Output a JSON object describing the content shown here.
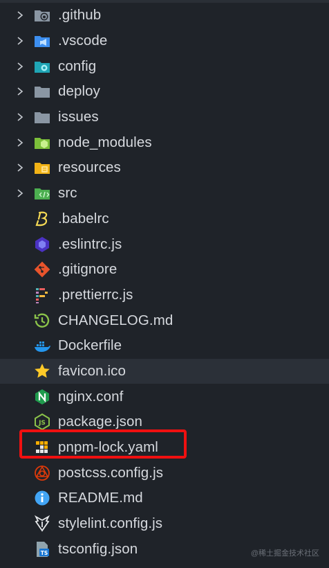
{
  "explorer": {
    "items": [
      {
        "label": ".github",
        "icon": "github-folder-icon",
        "folder": true
      },
      {
        "label": ".vscode",
        "icon": "vscode-folder-icon",
        "folder": true
      },
      {
        "label": "config",
        "icon": "config-folder-icon",
        "folder": true
      },
      {
        "label": "deploy",
        "icon": "folder-icon",
        "folder": true
      },
      {
        "label": "issues",
        "icon": "folder-icon",
        "folder": true
      },
      {
        "label": "node_modules",
        "icon": "node-folder-icon",
        "folder": true
      },
      {
        "label": "resources",
        "icon": "resources-folder-icon",
        "folder": true
      },
      {
        "label": "src",
        "icon": "src-folder-icon",
        "folder": true
      },
      {
        "label": ".babelrc",
        "icon": "babel-icon",
        "folder": false
      },
      {
        "label": ".eslintrc.js",
        "icon": "eslint-icon",
        "folder": false
      },
      {
        "label": ".gitignore",
        "icon": "git-icon",
        "folder": false
      },
      {
        "label": ".prettierrc.js",
        "icon": "prettier-icon",
        "folder": false
      },
      {
        "label": "CHANGELOG.md",
        "icon": "changelog-icon",
        "folder": false
      },
      {
        "label": "Dockerfile",
        "icon": "docker-icon",
        "folder": false
      },
      {
        "label": "favicon.ico",
        "icon": "star-icon",
        "folder": false
      },
      {
        "label": "nginx.conf",
        "icon": "nginx-icon",
        "folder": false
      },
      {
        "label": "package.json",
        "icon": "nodejs-icon",
        "folder": false
      },
      {
        "label": "pnpm-lock.yaml",
        "icon": "pnpm-icon",
        "folder": false
      },
      {
        "label": "postcss.config.js",
        "icon": "postcss-icon",
        "folder": false
      },
      {
        "label": "README.md",
        "icon": "info-icon",
        "folder": false
      },
      {
        "label": "stylelint.config.js",
        "icon": "stylelint-icon",
        "folder": false
      },
      {
        "label": "tsconfig.json",
        "icon": "tsconfig-icon",
        "folder": false
      }
    ],
    "hovered_item": "favicon.ico",
    "highlighted_item": "pnpm-lock.yaml",
    "highlight_color": "#f01010",
    "background": "#1f2329"
  },
  "watermark": "@稀土掘金技术社区"
}
